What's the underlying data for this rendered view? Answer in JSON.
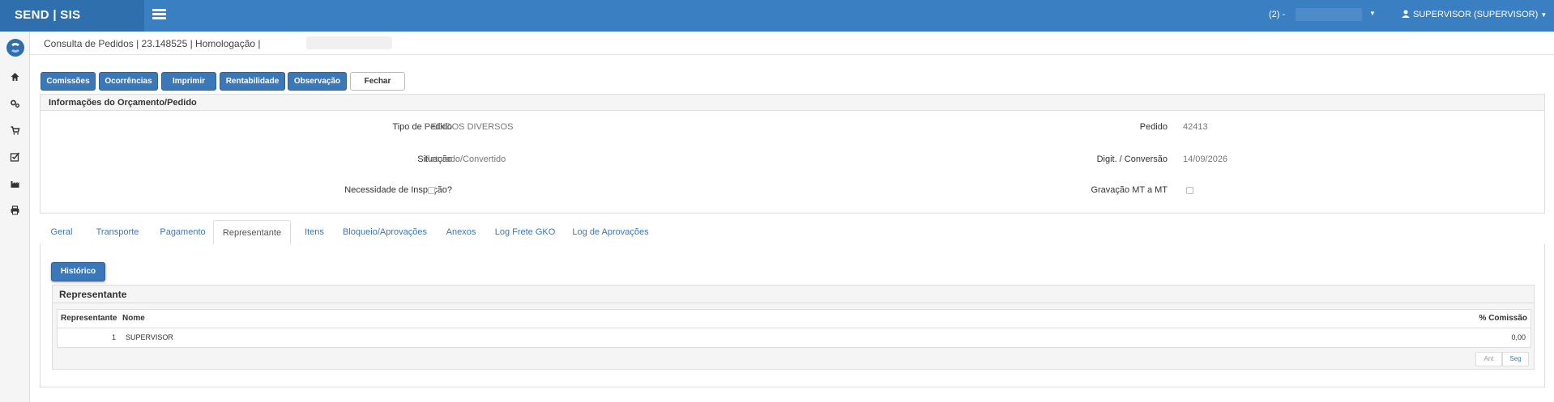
{
  "topbar": {
    "brand": "SEND | SIS",
    "branch_label": "(2) -",
    "user_label": "SUPERVISOR (SUPERVISOR)"
  },
  "page": {
    "title": "Consulta de Pedidos | 23.148525 | Homologação |"
  },
  "toolbar": {
    "comissoes": "Comissões",
    "ocorrencias": "Ocorrências",
    "imprimir": "Imprimir",
    "rentabilidade": "Rentabilidade",
    "observacao": "Observação",
    "fechar": "Fechar"
  },
  "info": {
    "title": "Informações do Orçamento/Pedido",
    "tipo_pedido_label": "Tipo de Pedido",
    "tipo_pedido_value": "PEDIDOS DIVERSOS",
    "pedido_label": "Pedido",
    "pedido_value": "42413",
    "situacao_label": "Situação",
    "situacao_value": "Faturado/Convertido",
    "digit_label": "Digit. / Conversão",
    "digit_value": "14/09/2026",
    "inspecao_label": "Necessidade de Inspeção?",
    "gravacao_label": "Gravação MT a MT"
  },
  "tabs": [
    "Geral",
    "Transporte",
    "Pagamento",
    "Representante",
    "Itens",
    "Bloqueio/Aprovações",
    "Anexos",
    "Log Frete GKO",
    "Log de Aprovações"
  ],
  "representante": {
    "historico_button": "Histórico",
    "panel_title": "Representante",
    "columns": [
      "Representante",
      "Nome",
      "% Comissão"
    ],
    "rows": [
      {
        "codigo": "1",
        "nome": "SUPERVISOR",
        "comissao": "0,00"
      }
    ],
    "pager_prev": "Ant",
    "pager_next": "Seg"
  },
  "colors": {
    "topbar": "#3a7fc1",
    "brand_bg": "#2f6fad",
    "button": "#3a78b9"
  }
}
